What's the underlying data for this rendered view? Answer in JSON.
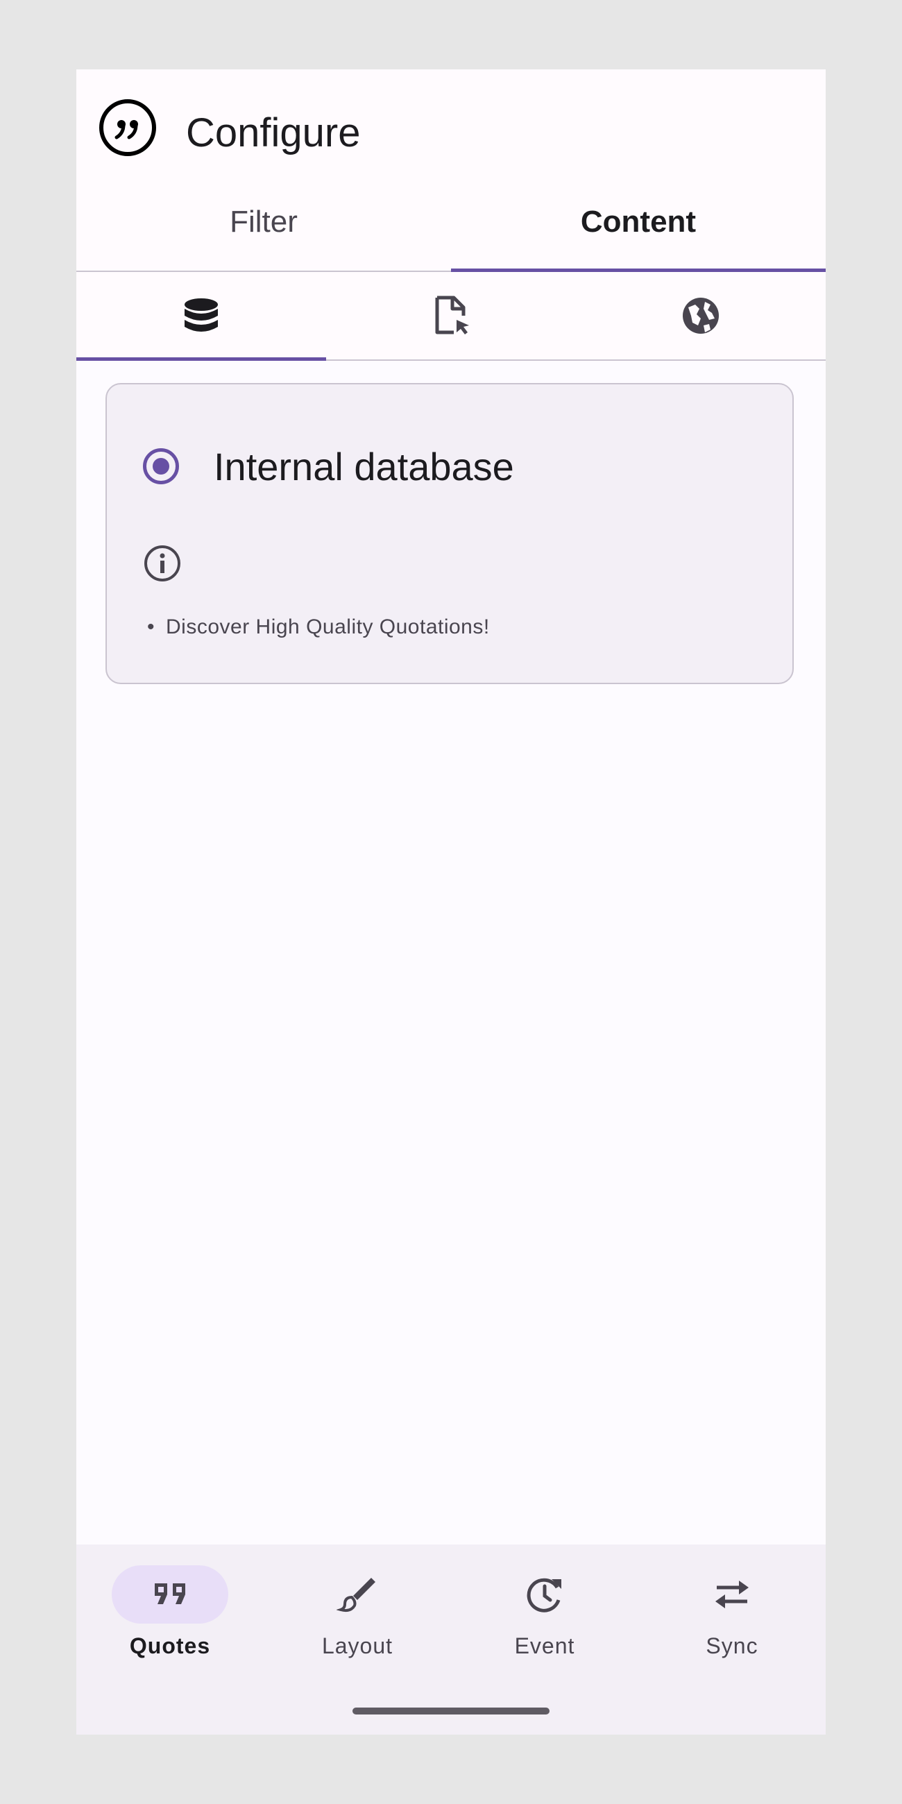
{
  "app": {
    "title": "Configure",
    "icon": "quote-bubble-icon"
  },
  "primary_tabs": [
    {
      "label": "Filter",
      "selected": false
    },
    {
      "label": "Content",
      "selected": true
    }
  ],
  "secondary_tabs": [
    {
      "icon": "database-icon",
      "selected": true
    },
    {
      "icon": "file-cursor-icon",
      "selected": false
    },
    {
      "icon": "globe-icon",
      "selected": false
    }
  ],
  "source_card": {
    "radio_label": "Internal database",
    "radio_selected": true,
    "info_icon": "info-icon",
    "bullet": "•",
    "description": "Discover High Quality Quotations!"
  },
  "bottom_nav": [
    {
      "label": "Quotes",
      "icon": "format-quote-icon",
      "active": true
    },
    {
      "label": "Layout",
      "icon": "brush-icon",
      "active": false
    },
    {
      "label": "Event",
      "icon": "history-icon",
      "active": false
    },
    {
      "label": "Sync",
      "icon": "swap-horiz-icon",
      "active": false
    }
  ],
  "colors": {
    "accent": "#6750a4",
    "active_pill": "#e8def8",
    "card_bg": "#f3eff6",
    "page_bg": "#fdfbff"
  }
}
